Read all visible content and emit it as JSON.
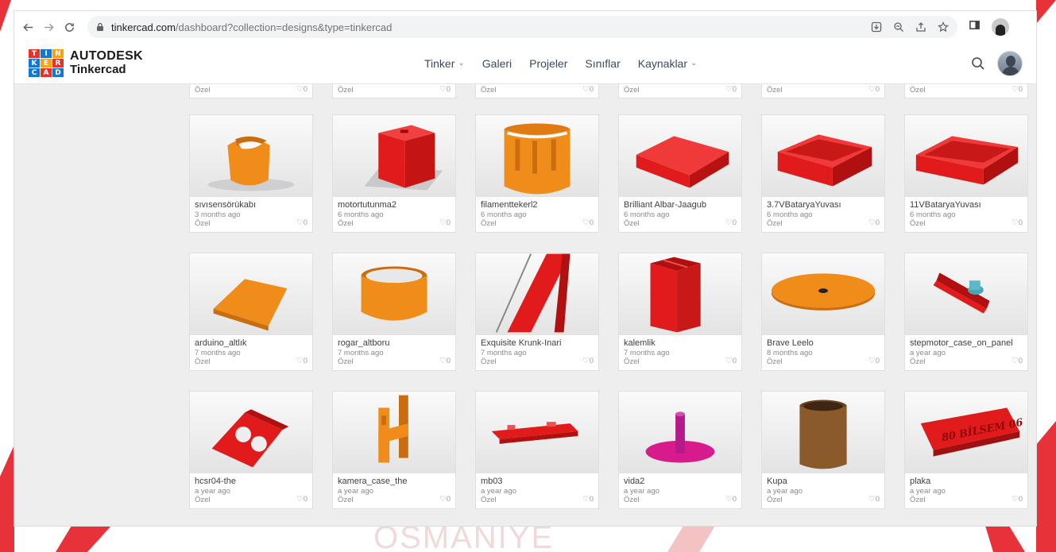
{
  "browser": {
    "url_host": "tinkercad.com",
    "url_path": "/dashboard?collection=designs&type=tinkercad"
  },
  "header": {
    "logo_letters": [
      "T",
      "I",
      "N",
      "K",
      "E",
      "R",
      "C",
      "A",
      "D"
    ],
    "logo_colors": [
      "#e5332a",
      "#1477d1",
      "#f3a31b",
      "#1477d1",
      "#f3a31b",
      "#e5332a",
      "#1477d1",
      "#e5332a",
      "#1477d1"
    ],
    "brand_line1": "AUTODESK",
    "brand_line2": "Tinkercad",
    "nav": [
      {
        "label": "Tinker",
        "caret": "⌄"
      },
      {
        "label": "Galeri",
        "caret": ""
      },
      {
        "label": "Projeler",
        "caret": ""
      },
      {
        "label": "Sınıflar",
        "caret": ""
      },
      {
        "label": "Kaynaklar",
        "caret": "⌄"
      }
    ]
  },
  "top_row": [
    {
      "privacy": "Özel",
      "likes": "0"
    },
    {
      "privacy": "Özel",
      "likes": "0"
    },
    {
      "privacy": "Özel",
      "likes": "0"
    },
    {
      "privacy": "Özel",
      "likes": "0"
    },
    {
      "privacy": "Özel",
      "likes": "0"
    },
    {
      "privacy": "Özel",
      "likes": "0"
    }
  ],
  "designs": [
    {
      "title": "sıvısensörükabı",
      "date": "3 months ago",
      "privacy": "Özel",
      "likes": "0",
      "icon": "orange-curved-cup"
    },
    {
      "title": "motortutunma2",
      "date": "6 months ago",
      "privacy": "Özel",
      "likes": "0",
      "icon": "red-box"
    },
    {
      "title": "filamenttekerl2",
      "date": "6 months ago",
      "privacy": "Özel",
      "likes": "0",
      "icon": "orange-slotted-cylinder"
    },
    {
      "title": "Brilliant Albar-Jaagub",
      "date": "6 months ago",
      "privacy": "Özel",
      "likes": "0",
      "icon": "red-flat-box"
    },
    {
      "title": "3.7VBataryaYuvası",
      "date": "6 months ago",
      "privacy": "Özel",
      "likes": "0",
      "icon": "red-tray"
    },
    {
      "title": "11VBataryaYuvası",
      "date": "6 months ago",
      "privacy": "Özel",
      "likes": "0",
      "icon": "red-tray-long"
    },
    {
      "title": "arduino_altlık",
      "date": "7 months ago",
      "privacy": "Özel",
      "likes": "0",
      "icon": "orange-plate"
    },
    {
      "title": "rogar_altboru",
      "date": "7 months ago",
      "privacy": "Özel",
      "likes": "0",
      "icon": "orange-ring"
    },
    {
      "title": "Exquisite Krunk-Inari",
      "date": "7 months ago",
      "privacy": "Özel",
      "likes": "0",
      "icon": "red-comb"
    },
    {
      "title": "kalemlik",
      "date": "7 months ago",
      "privacy": "Özel",
      "likes": "0",
      "icon": "red-pen-holder"
    },
    {
      "title": "Brave Leelo",
      "date": "8 months ago",
      "privacy": "Özel",
      "likes": "0",
      "icon": "orange-disc"
    },
    {
      "title": "stepmotor_case_on_panel",
      "date": "a year ago",
      "privacy": "Özel",
      "likes": "0",
      "icon": "red-rail"
    },
    {
      "title": "hcsr04-the",
      "date": "a year ago",
      "privacy": "Özel",
      "likes": "0",
      "icon": "red-sensor-bracket"
    },
    {
      "title": "kamera_case_the",
      "date": "a year ago",
      "privacy": "Özel",
      "likes": "0",
      "icon": "orange-bracket"
    },
    {
      "title": "mb03",
      "date": "a year ago",
      "privacy": "Özel",
      "likes": "0",
      "icon": "red-key"
    },
    {
      "title": "vida2",
      "date": "a year ago",
      "privacy": "Özel",
      "likes": "0",
      "icon": "magenta-screw"
    },
    {
      "title": "Kupa",
      "date": "a year ago",
      "privacy": "Özel",
      "likes": "0",
      "icon": "brown-cup"
    },
    {
      "title": "plaka",
      "date": "a year ago",
      "privacy": "Özel",
      "likes": "0",
      "icon": "red-plate-text",
      "plate_text": "80 BİLSEM 06"
    }
  ],
  "watermark": "OSMANIYE",
  "colors": {
    "red": "#e11b1b",
    "orange": "#f08c1a",
    "magenta": "#d81b8c",
    "brown": "#8b5a2b"
  }
}
